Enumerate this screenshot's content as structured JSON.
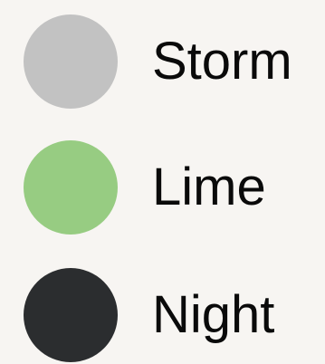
{
  "swatches": [
    {
      "label": "Storm",
      "color": "#c2c2c2"
    },
    {
      "label": "Lime",
      "color": "#97cc82"
    },
    {
      "label": "Night",
      "color": "#2b2d2f"
    }
  ]
}
